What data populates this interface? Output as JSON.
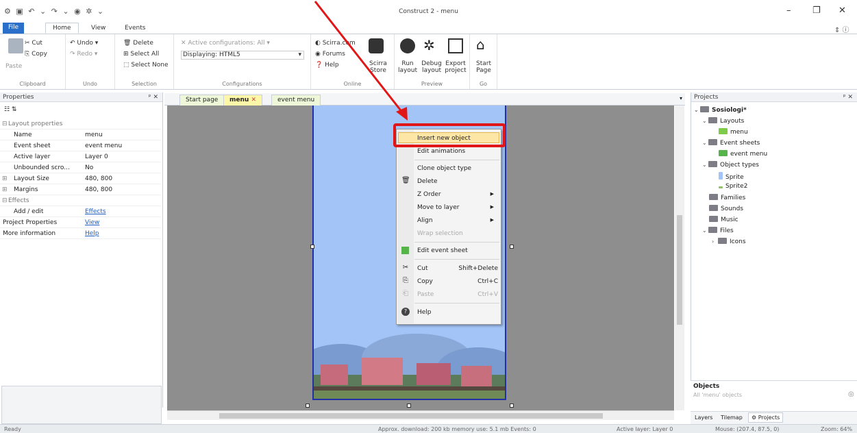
{
  "window": {
    "title": "Construct 2 - menu"
  },
  "ribbon_tabs": [
    "File",
    "Home",
    "View",
    "Events"
  ],
  "ribbon": {
    "clipboard": {
      "paste": "Paste",
      "cut": "Cut",
      "copy": "Copy",
      "label": "Clipboard"
    },
    "undo": {
      "undo": "Undo",
      "redo": "Redo",
      "label": "Undo"
    },
    "selection": {
      "delete": "Delete",
      "select_all": "Select All",
      "select_none": "Select None",
      "label": "Selection"
    },
    "configurations": {
      "active": "Active configurations: All",
      "displaying": "Displaying: HTML5",
      "label": "Configurations"
    },
    "online": {
      "scirra": "Scirra.com",
      "forums": "Forums",
      "help": "Help",
      "store": "Scirra Store",
      "label": "Online"
    },
    "preview": {
      "run": "Run layout",
      "debug": "Debug layout",
      "export": "Export project",
      "label": "Preview"
    },
    "go": {
      "start": "Start Page",
      "label": "Go"
    }
  },
  "properties": {
    "title": "Properties",
    "section_layout": "Layout properties",
    "rows": [
      {
        "k": "Name",
        "v": "menu"
      },
      {
        "k": "Event sheet",
        "v": "event menu"
      },
      {
        "k": "Active layer",
        "v": "Layer 0"
      },
      {
        "k": "Unbounded scro...",
        "v": "No"
      },
      {
        "k": "Layout Size",
        "v": "480, 800"
      },
      {
        "k": "Margins",
        "v": "480, 800"
      }
    ],
    "section_effects": "Effects",
    "add_edit": {
      "k": "Add / edit",
      "v": "Effects"
    },
    "project_props": {
      "k": "Project Properties",
      "v": "View"
    },
    "more_info": {
      "k": "More information",
      "v": "Help"
    }
  },
  "doc_tabs": [
    "Start page",
    "menu",
    "event menu"
  ],
  "context_menu": {
    "items": [
      "Insert new object",
      "Edit animations",
      "Clone object type",
      "Delete",
      "Z Order",
      "Move to layer",
      "Align",
      "Wrap selection",
      "Edit event sheet",
      "Cut",
      "Copy",
      "Paste",
      "Help"
    ],
    "shortcuts": {
      "cut": "Shift+Delete",
      "copy": "Ctrl+C",
      "paste": "Ctrl+V"
    }
  },
  "projects": {
    "title": "Projects",
    "root": "Sosiologi*",
    "layouts": "Layouts",
    "layout_menu": "menu",
    "event_sheets": "Event sheets",
    "event_menu": "event menu",
    "object_types": "Object types",
    "sprite": "Sprite",
    "sprite2": "Sprite2",
    "families": "Families",
    "sounds": "Sounds",
    "music": "Music",
    "files": "Files",
    "icons": "Icons"
  },
  "objects": {
    "title": "Objects",
    "placeholder": "All 'menu' objects"
  },
  "bottom_tabs": [
    "Layers",
    "Tilemap",
    "Projects"
  ],
  "status": {
    "ready": "Ready",
    "download": "Approx. download: 200 kb  memory use: 5.1 mb  Events: 0",
    "layer": "Active layer: Layer 0",
    "mouse": "Mouse: (207.4, 87.5, 0)",
    "zoom": "Zoom: 64%"
  }
}
